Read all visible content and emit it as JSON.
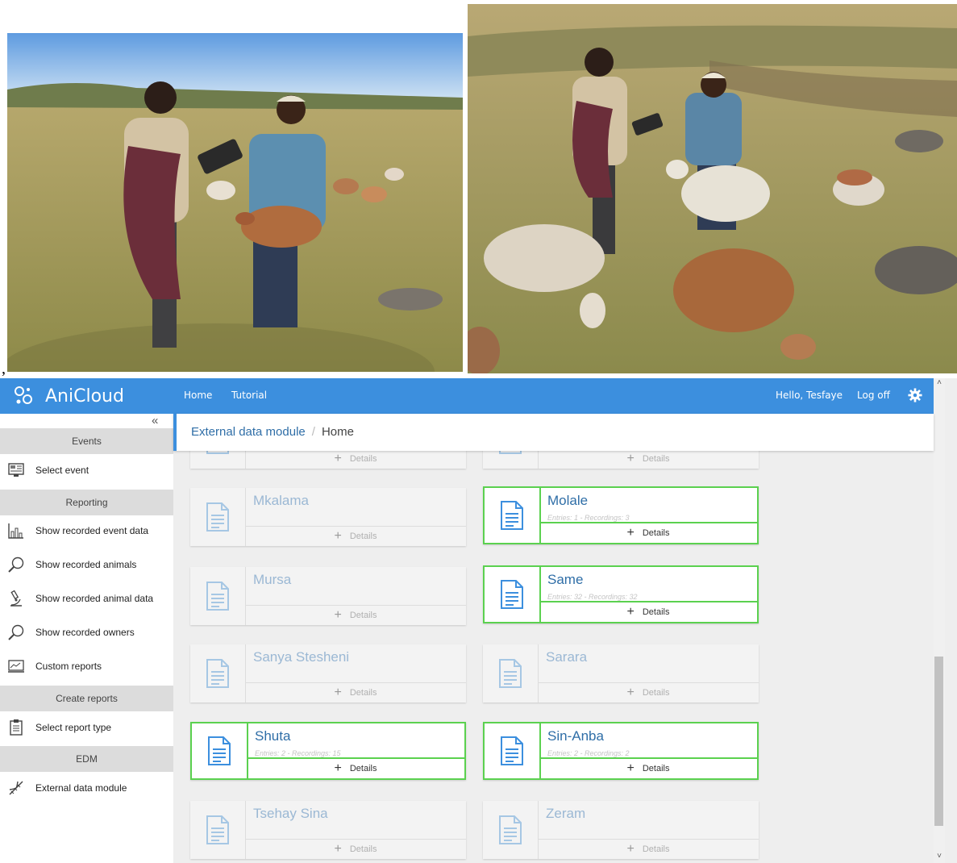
{
  "app": {
    "brand": "AniCloud",
    "nav": [
      "Home",
      "Tutorial"
    ],
    "greeting": "Hello, Tesfaye",
    "logoff": "Log off"
  },
  "separator": ",",
  "breadcrumb": {
    "parent": "External data module",
    "current": "Home"
  },
  "sidebar": {
    "collapse": "«",
    "sections": [
      {
        "title": "Events",
        "items": [
          {
            "label": "Select event",
            "icon": "monitor-icon"
          }
        ]
      },
      {
        "title": "Reporting",
        "items": [
          {
            "label": "Show recorded event data",
            "icon": "bar-chart-icon"
          },
          {
            "label": "Show recorded animals",
            "icon": "magnifier-icon"
          },
          {
            "label": "Show recorded animal data",
            "icon": "microscope-icon"
          },
          {
            "label": "Show recorded owners",
            "icon": "magnifier-icon"
          },
          {
            "label": "Custom reports",
            "icon": "report-icon"
          }
        ]
      },
      {
        "title": "Create reports",
        "items": [
          {
            "label": "Select report type",
            "icon": "document-icon"
          }
        ]
      },
      {
        "title": "EDM",
        "items": [
          {
            "label": "External data module",
            "icon": "dna-icon"
          }
        ]
      }
    ]
  },
  "details_label": "Details",
  "cards": [
    {
      "title": "",
      "meta": "",
      "active": false
    },
    {
      "title": "",
      "meta": "",
      "active": false
    },
    {
      "title": "Mkalama",
      "meta": "",
      "active": false
    },
    {
      "title": "Molale",
      "meta": "Entries: 1 - Recordings: 3",
      "active": true
    },
    {
      "title": "Mursa",
      "meta": "",
      "active": false
    },
    {
      "title": "Same",
      "meta": "Entries: 32 - Recordings: 32",
      "active": true
    },
    {
      "title": "Sanya Stesheni",
      "meta": "",
      "active": false
    },
    {
      "title": "Sarara",
      "meta": "",
      "active": false
    },
    {
      "title": "Shuta",
      "meta": "Entries: 2 - Recordings: 15",
      "active": true
    },
    {
      "title": "Sin-Anba",
      "meta": "Entries: 2 - Recordings: 2",
      "active": true
    },
    {
      "title": "Tsehay Sina",
      "meta": "",
      "active": false
    },
    {
      "title": "Zeram",
      "meta": "",
      "active": false
    }
  ],
  "colors": {
    "accent": "#3c8fde",
    "active_border": "#5bd14f",
    "title_active": "#2f6ea7"
  }
}
